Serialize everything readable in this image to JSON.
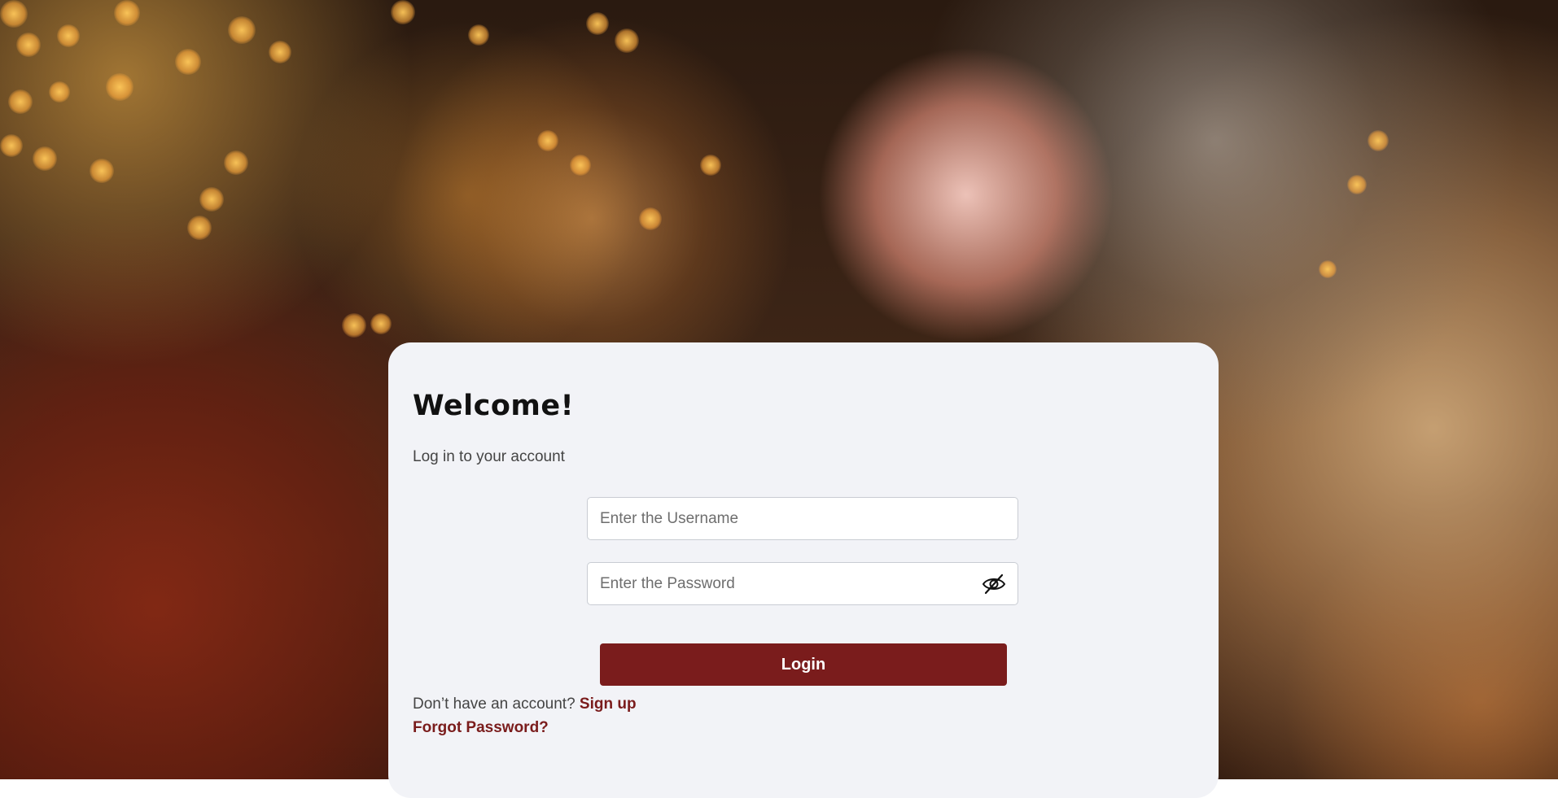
{
  "login": {
    "title": "Welcome!",
    "subtitle": "Log in to your account",
    "username_placeholder": "Enter the Username",
    "password_placeholder": "Enter the Password",
    "password_toggle_icon": "eye-slash-icon",
    "login_label": "Login",
    "no_account_text": "Don’t have an account?",
    "signup_label": "Sign up",
    "forgot_label": "Forgot Password?"
  },
  "colors": {
    "accent": "#7a1c1c",
    "card_background": "#f2f3f7"
  }
}
